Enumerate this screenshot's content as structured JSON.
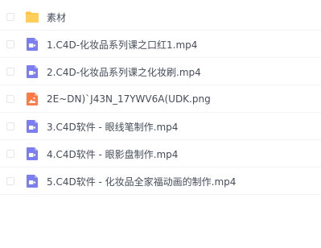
{
  "files": [
    {
      "name": "素材",
      "type": "folder",
      "icon": "folder-icon",
      "color": "#ffc53d"
    },
    {
      "name": "1.C4D-化妆品系列课之口红1.mp4",
      "type": "video",
      "icon": "video-file-icon",
      "color": "#7b7ef0"
    },
    {
      "name": "2.C4D-化妆品系列课之化妆刷.mp4",
      "type": "video",
      "icon": "video-file-icon",
      "color": "#7b7ef0"
    },
    {
      "name": "2E~DN)`J43N_17YWV6A(UDK.png",
      "type": "image",
      "icon": "image-file-icon",
      "color": "#ff7a45"
    },
    {
      "name": "3.C4D软件 - 眼线笔制作.mp4",
      "type": "video",
      "icon": "video-file-icon",
      "color": "#7b7ef0"
    },
    {
      "name": "4.C4D软件 - 眼影盘制作.mp4",
      "type": "video",
      "icon": "video-file-icon",
      "color": "#7b7ef0"
    },
    {
      "name": "5.C4D软件 - 化妆品全家福动画的制作.mp4",
      "type": "video",
      "icon": "video-file-icon",
      "color": "#7b7ef0"
    }
  ]
}
